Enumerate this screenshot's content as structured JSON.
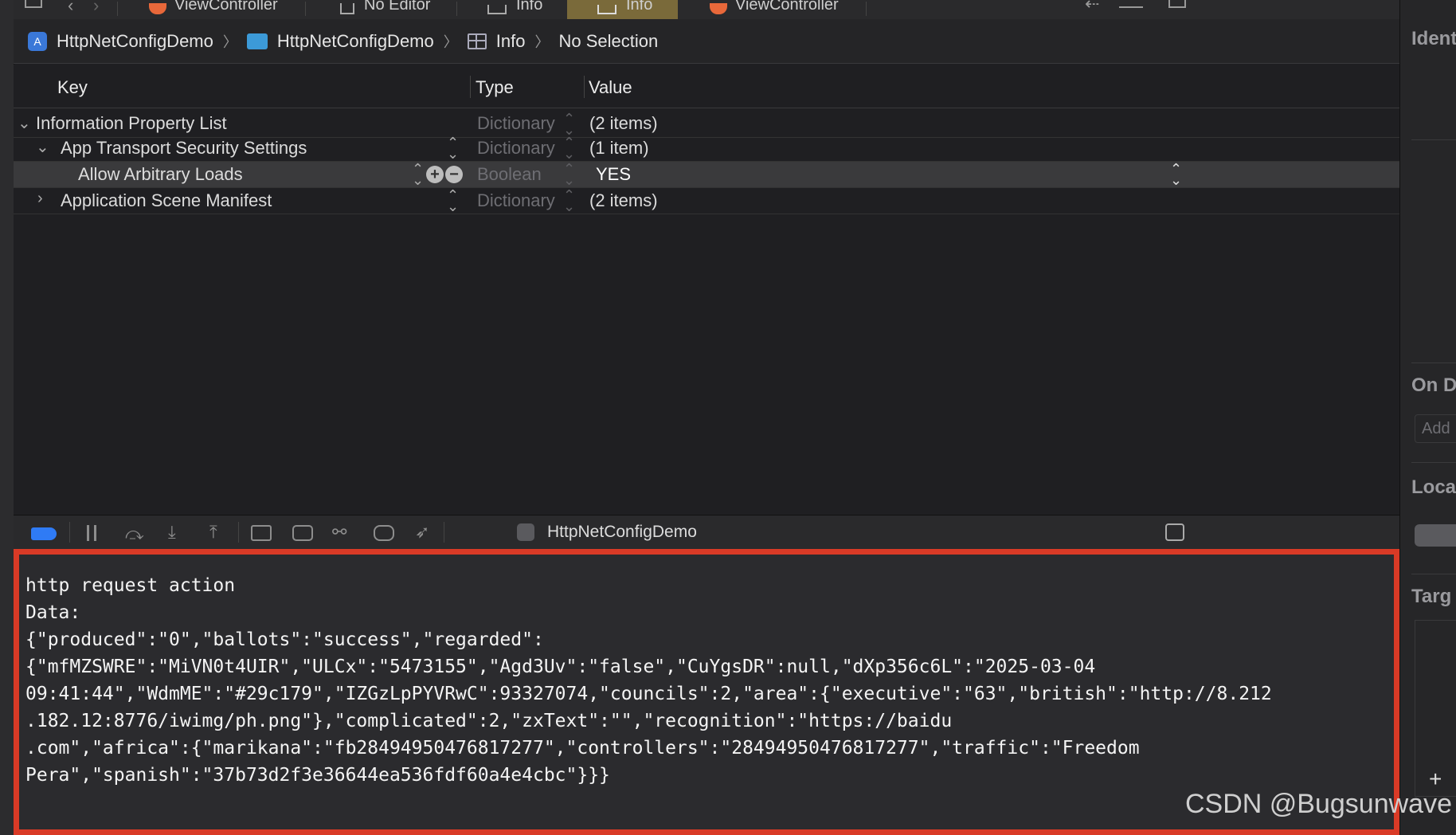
{
  "tabbar": {
    "tabs": [
      {
        "label": "ViewController",
        "icon": "swift-icon"
      },
      {
        "label": "No Editor",
        "icon": "document-icon"
      },
      {
        "label": "Info",
        "icon": "table-icon"
      },
      {
        "label": "Info",
        "icon": "table-icon",
        "active": true
      },
      {
        "label": "ViewController",
        "icon": "swift-icon"
      }
    ]
  },
  "breadcrumb": {
    "project": "HttpNetConfigDemo",
    "folder": "HttpNetConfigDemo",
    "file": "Info",
    "selection": "No Selection"
  },
  "plist": {
    "columns": {
      "key": "Key",
      "type": "Type",
      "value": "Value"
    },
    "rows": [
      {
        "key": "Information Property List",
        "type": "Dictionary",
        "value": "(2 items)",
        "expanded": true
      },
      {
        "key": "App Transport Security Settings",
        "type": "Dictionary",
        "value": "(1 item)",
        "expanded": true
      },
      {
        "key": "Allow Arbitrary Loads",
        "type": "Boolean",
        "value": "YES",
        "selected": true
      },
      {
        "key": "Application Scene Manifest",
        "type": "Dictionary",
        "value": "(2 items)",
        "expanded": false
      }
    ]
  },
  "debugbar": {
    "target": "HttpNetConfigDemo"
  },
  "console": {
    "lines": [
      "http request action",
      "Data:",
      "{\"produced\":\"0\",\"ballots\":\"success\",\"regarded\":",
      "{\"mfMZSWRE\":\"MiVN0t4UIR\",\"ULCx\":\"5473155\",\"Agd3Uv\":\"false\",\"CuYgsDR\":null,\"dXp356c6L\":\"2025-03-04",
      "09:41:44\",\"WdmME\":\"#29c179\",\"IZGzLpPYVRwC\":93327074,\"councils\":2,\"area\":{\"executive\":\"63\",\"british\":\"http://8.212",
      ".182.12:8776/iwimg/ph.png\"},\"complicated\":2,\"zxText\":\"\",\"recognition\":\"https://baidu",
      ".com\",\"africa\":{\"marikana\":\"fb28494950476817277\",\"controllers\":\"28494950476817277\",\"traffic\":\"Freedom",
      "Pera\",\"spanish\":\"37b73d2f3e36644ea536fdf60a4e4cbc\"}}}"
    ]
  },
  "inspector": {
    "identity_heading": "Ident",
    "on_demand_heading": "On D",
    "add_placeholder": "Add",
    "localization_heading": "Loca",
    "target_heading": "Targ",
    "add_button": "+"
  },
  "watermark": "CSDN @Bugsunwave",
  "colors": {
    "highlight_border": "#d93a26",
    "active_tab": "#7a6a3a",
    "breakpoint": "#2f7bf5"
  }
}
